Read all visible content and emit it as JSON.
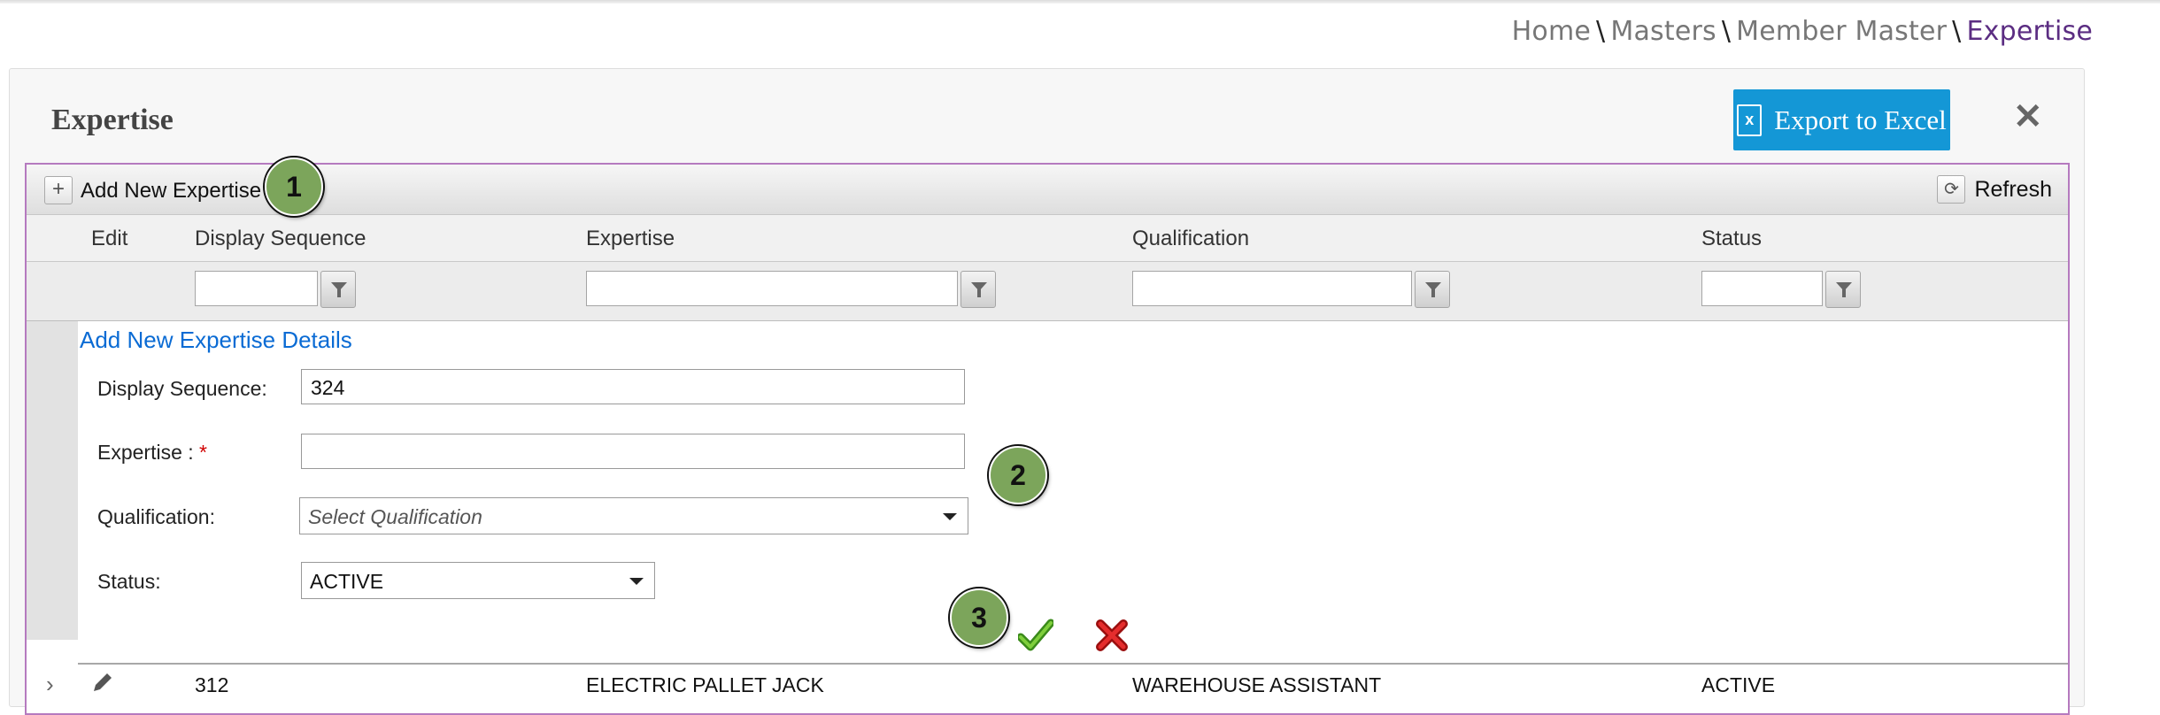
{
  "breadcrumb": {
    "home": "Home",
    "masters": "Masters",
    "member_master": "Member Master",
    "current": "Expertise",
    "separator": "\\"
  },
  "page": {
    "title": "Expertise",
    "export_label": "Export to Excel",
    "export_icon": "excel-icon",
    "close_icon": "close-icon"
  },
  "toolbar": {
    "add_label": "Add New Expertise",
    "refresh_label": "Refresh"
  },
  "columns": {
    "edit": "Edit",
    "display_sequence": "Display Sequence",
    "expertise": "Expertise",
    "qualification": "Qualification",
    "status": "Status"
  },
  "form": {
    "title": "Add New Expertise Details",
    "display_sequence_label": "Display Sequence:",
    "display_sequence_value": "324",
    "expertise_label": "Expertise : ",
    "required_mark": "*",
    "expertise_value": "",
    "qualification_label": "Qualification:",
    "qualification_placeholder": "Select Qualification",
    "status_label": "Status:",
    "status_value": "ACTIVE"
  },
  "rows": [
    {
      "display_sequence": "312",
      "expertise": "ELECTRIC PALLET JACK",
      "qualification": "WAREHOUSE ASSISTANT",
      "status": "ACTIVE"
    }
  ],
  "steps": [
    "1",
    "2",
    "3"
  ],
  "colors": {
    "accent": "#1497d6",
    "grid_border": "#b57abf",
    "link": "#0a6bd4",
    "step_badge": "#7ca55b",
    "breadcrumb_current": "#5b2d82"
  }
}
